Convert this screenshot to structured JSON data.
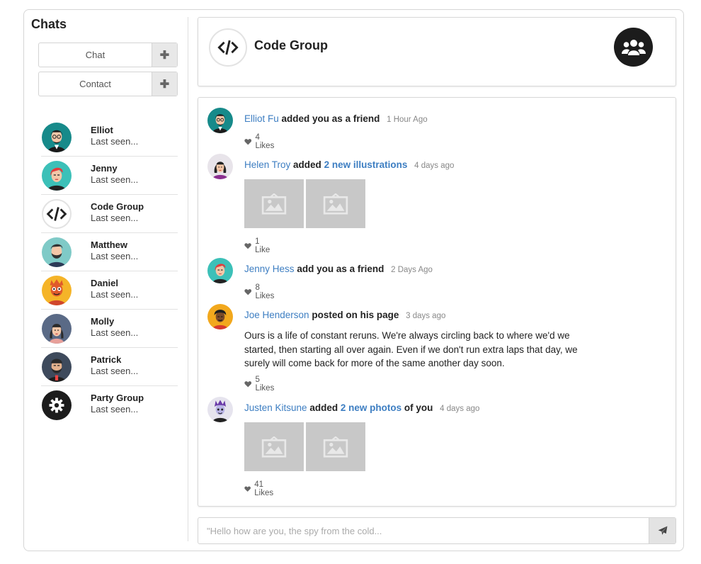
{
  "sidebar": {
    "title": "Chats",
    "chat_button": "Chat",
    "contact_button": "Contact",
    "plus_glyph": "✚",
    "contacts": [
      {
        "name": "Elliot",
        "status": "Last seen...",
        "avatar": "elliot-avatar"
      },
      {
        "name": "Jenny",
        "status": "Last seen...",
        "avatar": "jenny-avatar"
      },
      {
        "name": "Code Group",
        "status": "Last seen...",
        "avatar": "code-icon"
      },
      {
        "name": "Matthew",
        "status": "Last seen...",
        "avatar": "matthew-avatar"
      },
      {
        "name": "Daniel",
        "status": "Last seen...",
        "avatar": "daniel-avatar"
      },
      {
        "name": "Molly",
        "status": "Last seen...",
        "avatar": "molly-avatar"
      },
      {
        "name": "Patrick",
        "status": "Last seen...",
        "avatar": "patrick-avatar"
      },
      {
        "name": "Party Group",
        "status": "Last seen...",
        "avatar": "gear-icon"
      }
    ]
  },
  "header": {
    "title": "Code Group",
    "group_icon": "users-icon"
  },
  "feed": [
    {
      "user": "Elliot Fu",
      "verb": "added you as a friend",
      "date": "1 Hour Ago",
      "likes": "4 Likes"
    },
    {
      "user": "Helen Troy",
      "verb": "added",
      "link": "2 new illustrations",
      "date": "4 days ago",
      "likes": "1 Like",
      "images": 2
    },
    {
      "user": "Jenny Hess",
      "verb": "add you as a friend",
      "date": "2 Days Ago",
      "likes": "8 Likes"
    },
    {
      "user": "Joe Henderson",
      "verb": "posted on his page",
      "date": "3 days ago",
      "likes": "5 Likes",
      "text": "Ours is a life of constant reruns. We're always circling back to where we'd we started, then starting all over again. Even if we don't run extra laps that day, we surely will come back for more of the same another day soon."
    },
    {
      "user": "Justen Kitsune",
      "verb": "added",
      "link": "2 new photos",
      "suffix": "of you",
      "date": "4 days ago",
      "likes": "41 Likes",
      "images": 2
    }
  ],
  "composer": {
    "placeholder": "\"Hello how are you, the spy from the cold...",
    "send_icon": "paper-plane-icon"
  },
  "colors": {
    "link": "#3d7ec2",
    "muted": "#888888",
    "thumb_bg": "#c8c8c8",
    "dark_circle": "#1c1c1c"
  }
}
